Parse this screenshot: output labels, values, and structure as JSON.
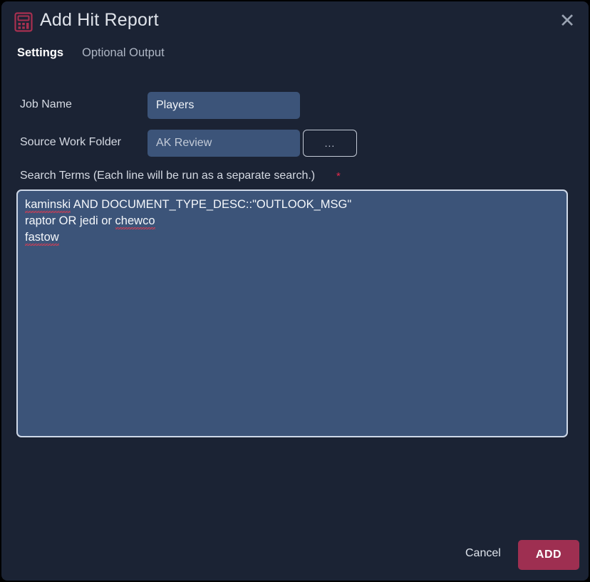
{
  "window": {
    "title": "Add Hit Report",
    "icon": "calculator-report-icon",
    "close_label": "✕",
    "accent_color": "#9e2f51",
    "background_color": "#1b2334",
    "field_fill_color": "#3c5479"
  },
  "tabs": [
    {
      "label": "Settings",
      "active": true
    },
    {
      "label": "Optional Output",
      "active": false
    }
  ],
  "form": {
    "job_name": {
      "label": "Job Name",
      "value": "Players",
      "placeholder": "Job Name"
    },
    "source_work_folder": {
      "label": "Source Work Folder",
      "value": "AK Review",
      "placeholder": "Source Work Folder",
      "browse_label": "..."
    },
    "search_terms": {
      "label": "Search Terms (Each line will be run as a separate search.)",
      "required_marker": "*",
      "lines": [
        {
          "segments": [
            {
              "text": "kaminski",
              "misspelled": true
            },
            {
              "text": " AND DOCUMENT_TYPE_DESC::\"OUTLOOK_MSG\"",
              "misspelled": false
            }
          ]
        },
        {
          "segments": [
            {
              "text": "raptor OR jedi or ",
              "misspelled": false
            },
            {
              "text": "chewco",
              "misspelled": true
            }
          ]
        },
        {
          "segments": [
            {
              "text": "fastow",
              "misspelled": true
            }
          ]
        }
      ]
    }
  },
  "footer": {
    "cancel_label": "Cancel",
    "add_label": "ADD"
  }
}
